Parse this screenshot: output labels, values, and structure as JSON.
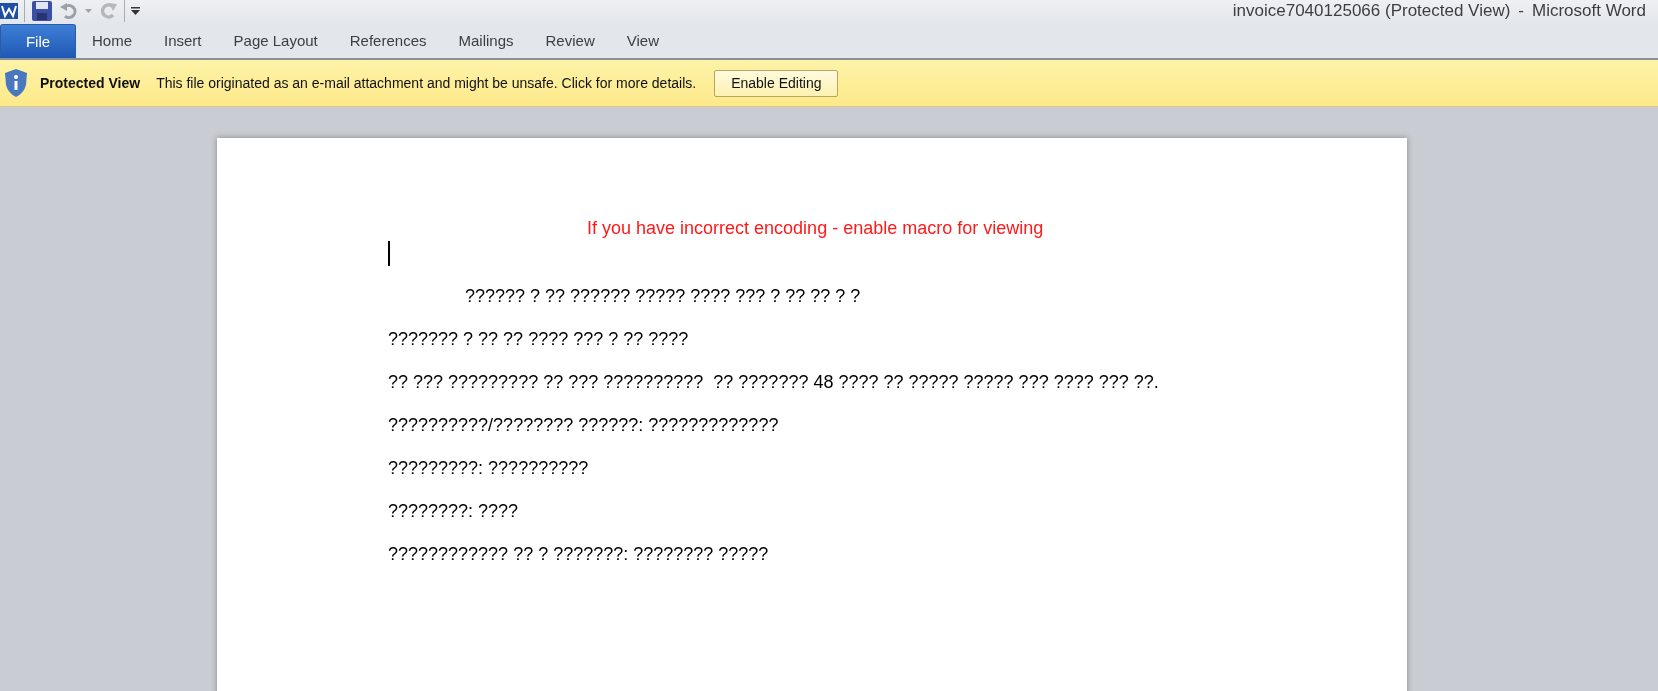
{
  "window": {
    "title": "invoice7040125066 (Protected View)",
    "separator": "-",
    "app_name": "Microsoft Word"
  },
  "ribbon_tabs": [
    {
      "label": "File",
      "kind": "file"
    },
    {
      "label": "Home",
      "kind": "tab"
    },
    {
      "label": "Insert",
      "kind": "tab"
    },
    {
      "label": "Page Layout",
      "kind": "tab"
    },
    {
      "label": "References",
      "kind": "tab"
    },
    {
      "label": "Mailings",
      "kind": "tab"
    },
    {
      "label": "Review",
      "kind": "tab"
    },
    {
      "label": "View",
      "kind": "tab"
    }
  ],
  "message_bar": {
    "title": "Protected View",
    "message": "This file originated as an e-mail attachment and might be unsafe. Click for more details.",
    "button": "Enable Editing"
  },
  "document": {
    "notice": "If you have incorrect encoding - enable macro for viewing",
    "paragraphs": [
      {
        "text": "?????? ? ?? ?????? ????? ???? ??? ? ?? ?? ? ?",
        "indented": true
      },
      {
        "text": "??????? ? ?? ?? ???? ??? ? ?? ????",
        "indented": false
      },
      {
        "text": "?? ??? ????????? ?? ??? ??????????  ?? ??????? 48 ???? ?? ????? ????? ??? ???? ??? ??.",
        "indented": false
      },
      {
        "text": "??????????/???????? ??????: ?????????????",
        "indented": false
      },
      {
        "text": "?????????: ??????????",
        "indented": false
      },
      {
        "text": "????????: ????",
        "indented": false
      },
      {
        "text": "???????????? ?? ? ???????: ???????? ?????",
        "indented": false
      }
    ]
  }
}
